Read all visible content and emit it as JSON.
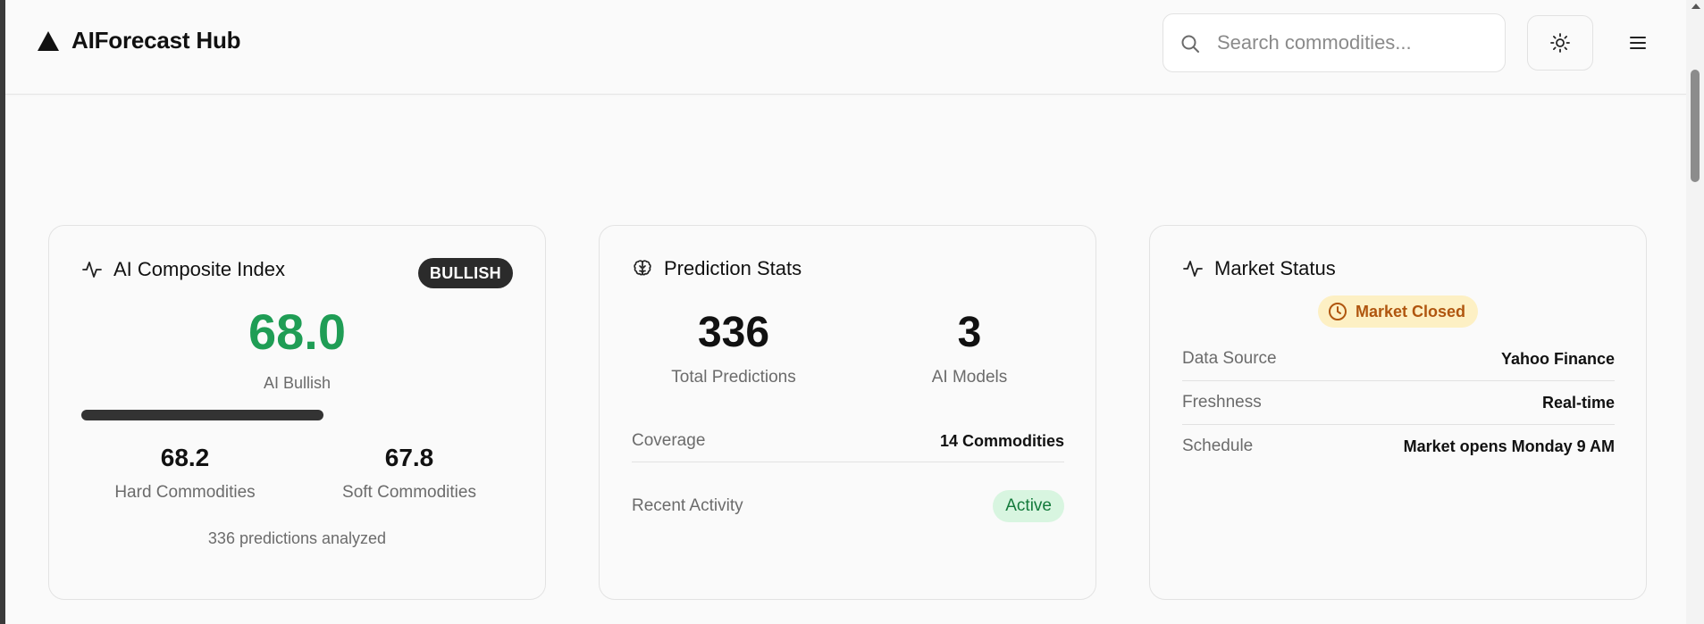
{
  "header": {
    "brand": "AIForecast Hub",
    "search_placeholder": "Search commodities..."
  },
  "icons": {
    "brand": "triangle-logo-icon",
    "search": "search-icon",
    "theme": "sun-icon",
    "menu": "hamburger-menu-icon",
    "composite": "activity-pulse-icon",
    "prediction": "brain-icon",
    "market": "activity-pulse-icon",
    "market_closed": "clock-icon"
  },
  "colors": {
    "bullish_green": "#1f9d55",
    "active_green": "#147a3b",
    "closed_amber": "#b0560f"
  },
  "composite": {
    "title": "AI Composite Index",
    "badge": "BULLISH",
    "value": "68.0",
    "sentiment": "AI Bullish",
    "progress_fraction": 0.56,
    "hard_value": "68.2",
    "hard_label": "Hard Commodities",
    "soft_value": "67.8",
    "soft_label": "Soft Commodities",
    "footnote": "336 predictions analyzed"
  },
  "prediction": {
    "title": "Prediction Stats",
    "total_value": "336",
    "total_label": "Total Predictions",
    "models_value": "3",
    "models_label": "AI Models",
    "coverage_label": "Coverage",
    "coverage_value": "14 Commodities",
    "activity_label": "Recent Activity",
    "activity_value": "Active"
  },
  "market": {
    "title": "Market Status",
    "status": "Market Closed",
    "rows": [
      {
        "label": "Data Source",
        "value": "Yahoo Finance"
      },
      {
        "label": "Freshness",
        "value": "Real-time"
      },
      {
        "label": "Schedule",
        "value": "Market opens Monday 9 AM"
      }
    ]
  }
}
